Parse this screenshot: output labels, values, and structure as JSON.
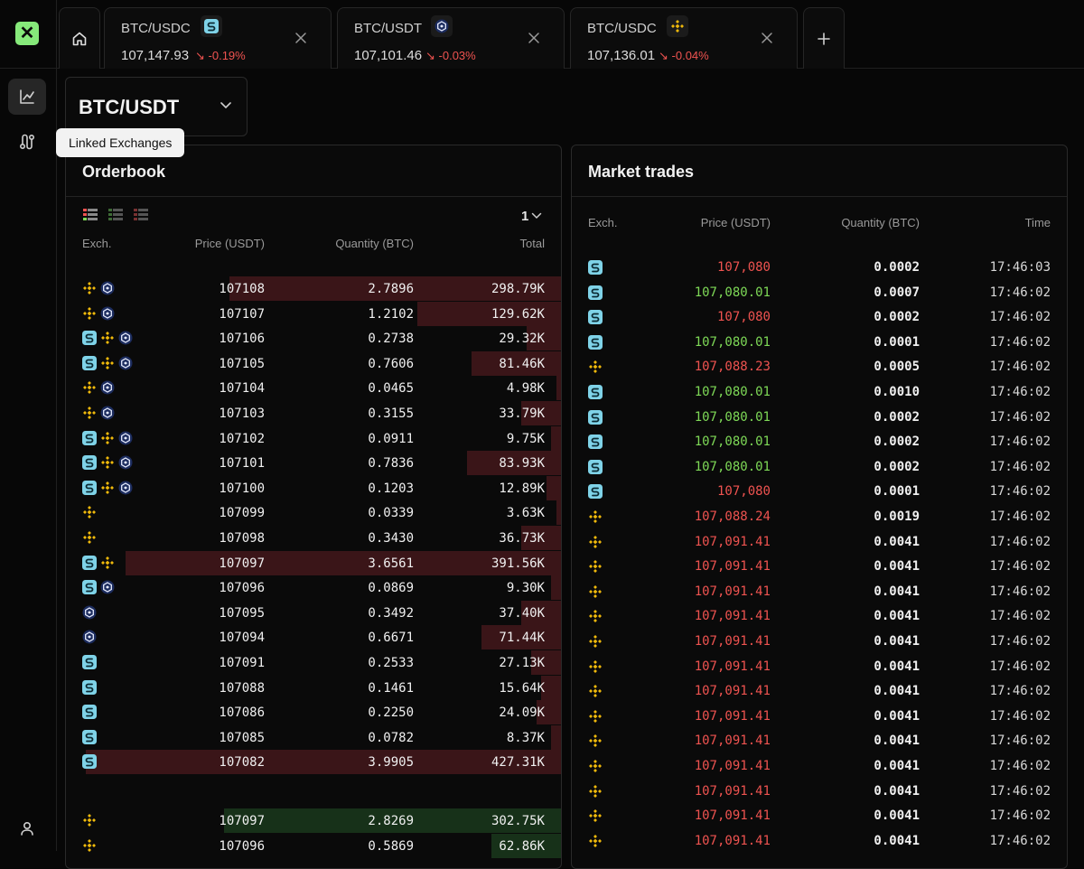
{
  "app": {
    "logo": "✕",
    "tooltip": "Linked Exchanges",
    "colors": {
      "ask": "#ef5350",
      "bid": "#7ed957",
      "accent": "#86e97a"
    },
    "icons": {
      "nav_chart": "chart-icon",
      "nav_linked": "linked-exchanges-icon",
      "nav_user": "user-icon",
      "home": "home-icon",
      "add": "plus-icon"
    }
  },
  "tabs": [
    {
      "pair": "BTC/USDC",
      "exchange": "s",
      "price": "107,147.93",
      "change": "-0.19%"
    },
    {
      "pair": "BTC/USDT",
      "exchange": "c",
      "price": "107,101.46",
      "change": "-0.03%"
    },
    {
      "pair": "BTC/USDC",
      "exchange": "b",
      "price": "107,136.01",
      "change": "-0.04%"
    }
  ],
  "pair_selector": {
    "label": "BTC/USDT"
  },
  "orderbook": {
    "title": "Orderbook",
    "granularity": "1",
    "headers": {
      "exch": "Exch.",
      "price": "Price (USDT)",
      "qty": "Quantity (BTC)",
      "total": "Total"
    },
    "asks": [
      {
        "ex": [
          "b",
          "c"
        ],
        "price": "107108",
        "qty": "2.7896",
        "total": "298.79K",
        "depth": 0.67
      },
      {
        "ex": [
          "b",
          "c"
        ],
        "price": "107107",
        "qty": "1.2102",
        "total": "129.62K",
        "depth": 0.29
      },
      {
        "ex": [
          "s",
          "b",
          "c"
        ],
        "price": "107106",
        "qty": "0.2738",
        "total": "29.32K",
        "depth": 0.07
      },
      {
        "ex": [
          "s",
          "b",
          "c"
        ],
        "price": "107105",
        "qty": "0.7606",
        "total": "81.46K",
        "depth": 0.18
      },
      {
        "ex": [
          "b",
          "c"
        ],
        "price": "107104",
        "qty": "0.0465",
        "total": "4.98K",
        "depth": 0.01
      },
      {
        "ex": [
          "b",
          "c"
        ],
        "price": "107103",
        "qty": "0.3155",
        "total": "33.79K",
        "depth": 0.08
      },
      {
        "ex": [
          "s",
          "b",
          "c"
        ],
        "price": "107102",
        "qty": "0.0911",
        "total": "9.75K",
        "depth": 0.02
      },
      {
        "ex": [
          "s",
          "b",
          "c"
        ],
        "price": "107101",
        "qty": "0.7836",
        "total": "83.93K",
        "depth": 0.19
      },
      {
        "ex": [
          "s",
          "b",
          "c"
        ],
        "price": "107100",
        "qty": "0.1203",
        "total": "12.89K",
        "depth": 0.03
      },
      {
        "ex": [
          "b"
        ],
        "price": "107099",
        "qty": "0.0339",
        "total": "3.63K",
        "depth": 0.01
      },
      {
        "ex": [
          "b"
        ],
        "price": "107098",
        "qty": "0.3430",
        "total": "36.73K",
        "depth": 0.08
      },
      {
        "ex": [
          "s",
          "b"
        ],
        "price": "107097",
        "qty": "3.6561",
        "total": "391.56K",
        "depth": 0.88
      },
      {
        "ex": [
          "s",
          "c"
        ],
        "price": "107096",
        "qty": "0.0869",
        "total": "9.30K",
        "depth": 0.02
      },
      {
        "ex": [
          "c"
        ],
        "price": "107095",
        "qty": "0.3492",
        "total": "37.40K",
        "depth": 0.08
      },
      {
        "ex": [
          "c"
        ],
        "price": "107094",
        "qty": "0.6671",
        "total": "71.44K",
        "depth": 0.16
      },
      {
        "ex": [
          "s"
        ],
        "price": "107091",
        "qty": "0.2533",
        "total": "27.13K",
        "depth": 0.06
      },
      {
        "ex": [
          "s"
        ],
        "price": "107088",
        "qty": "0.1461",
        "total": "15.64K",
        "depth": 0.04
      },
      {
        "ex": [
          "s"
        ],
        "price": "107086",
        "qty": "0.2250",
        "total": "24.09K",
        "depth": 0.05
      },
      {
        "ex": [
          "s"
        ],
        "price": "107085",
        "qty": "0.0782",
        "total": "8.37K",
        "depth": 0.02
      },
      {
        "ex": [
          "s"
        ],
        "price": "107082",
        "qty": "3.9905",
        "total": "427.31K",
        "depth": 0.96
      }
    ],
    "bids": [
      {
        "ex": [
          "b"
        ],
        "price": "107097",
        "qty": "2.8269",
        "total": "302.75K",
        "depth": 0.68
      },
      {
        "ex": [
          "b"
        ],
        "price": "107096",
        "qty": "0.5869",
        "total": "62.86K",
        "depth": 0.14
      }
    ]
  },
  "market_trades": {
    "title": "Market trades",
    "headers": {
      "exch": "Exch.",
      "price": "Price (USDT)",
      "qty": "Quantity (BTC)",
      "time": "Time"
    },
    "rows": [
      {
        "ex": "s",
        "side": "sell",
        "price": "107,080",
        "qty": "0.0002",
        "time": "17:46:03"
      },
      {
        "ex": "s",
        "side": "buy",
        "price": "107,080.01",
        "qty": "0.0007",
        "time": "17:46:02"
      },
      {
        "ex": "s",
        "side": "sell",
        "price": "107,080",
        "qty": "0.0002",
        "time": "17:46:02"
      },
      {
        "ex": "s",
        "side": "buy",
        "price": "107,080.01",
        "qty": "0.0001",
        "time": "17:46:02"
      },
      {
        "ex": "b",
        "side": "sell",
        "price": "107,088.23",
        "qty": "0.0005",
        "time": "17:46:02"
      },
      {
        "ex": "s",
        "side": "buy",
        "price": "107,080.01",
        "qty": "0.0010",
        "time": "17:46:02"
      },
      {
        "ex": "s",
        "side": "buy",
        "price": "107,080.01",
        "qty": "0.0002",
        "time": "17:46:02"
      },
      {
        "ex": "s",
        "side": "buy",
        "price": "107,080.01",
        "qty": "0.0002",
        "time": "17:46:02"
      },
      {
        "ex": "s",
        "side": "buy",
        "price": "107,080.01",
        "qty": "0.0002",
        "time": "17:46:02"
      },
      {
        "ex": "s",
        "side": "sell",
        "price": "107,080",
        "qty": "0.0001",
        "time": "17:46:02"
      },
      {
        "ex": "b",
        "side": "sell",
        "price": "107,088.24",
        "qty": "0.0019",
        "time": "17:46:02"
      },
      {
        "ex": "b",
        "side": "sell",
        "price": "107,091.41",
        "qty": "0.0041",
        "time": "17:46:02"
      },
      {
        "ex": "b",
        "side": "sell",
        "price": "107,091.41",
        "qty": "0.0041",
        "time": "17:46:02"
      },
      {
        "ex": "b",
        "side": "sell",
        "price": "107,091.41",
        "qty": "0.0041",
        "time": "17:46:02"
      },
      {
        "ex": "b",
        "side": "sell",
        "price": "107,091.41",
        "qty": "0.0041",
        "time": "17:46:02"
      },
      {
        "ex": "b",
        "side": "sell",
        "price": "107,091.41",
        "qty": "0.0041",
        "time": "17:46:02"
      },
      {
        "ex": "b",
        "side": "sell",
        "price": "107,091.41",
        "qty": "0.0041",
        "time": "17:46:02"
      },
      {
        "ex": "b",
        "side": "sell",
        "price": "107,091.41",
        "qty": "0.0041",
        "time": "17:46:02"
      },
      {
        "ex": "b",
        "side": "sell",
        "price": "107,091.41",
        "qty": "0.0041",
        "time": "17:46:02"
      },
      {
        "ex": "b",
        "side": "sell",
        "price": "107,091.41",
        "qty": "0.0041",
        "time": "17:46:02"
      },
      {
        "ex": "b",
        "side": "sell",
        "price": "107,091.41",
        "qty": "0.0041",
        "time": "17:46:02"
      },
      {
        "ex": "b",
        "side": "sell",
        "price": "107,091.41",
        "qty": "0.0041",
        "time": "17:46:02"
      },
      {
        "ex": "b",
        "side": "sell",
        "price": "107,091.41",
        "qty": "0.0041",
        "time": "17:46:02"
      },
      {
        "ex": "b",
        "side": "sell",
        "price": "107,091.41",
        "qty": "0.0041",
        "time": "17:46:02"
      }
    ]
  }
}
